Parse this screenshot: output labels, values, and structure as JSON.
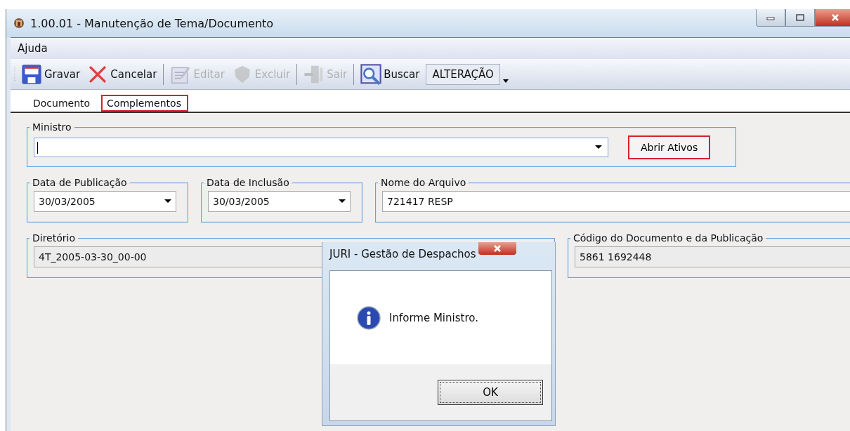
{
  "window": {
    "title": "1.00.01 - Manutenção de Tema/Documento"
  },
  "menu": [
    {
      "label": "Ajuda"
    }
  ],
  "toolbar": [
    {
      "label": "Gravar",
      "disabled": false
    },
    {
      "label": "Cancelar",
      "disabled": false
    },
    {
      "label": "Editar",
      "disabled": true
    },
    {
      "label": "Excluir",
      "disabled": true
    },
    {
      "label": "Sair",
      "disabled": true
    },
    {
      "label": "Buscar",
      "disabled": false
    }
  ],
  "mode": {
    "value": "ALTERAÇÃO"
  },
  "tabs": [
    {
      "label": "Documento",
      "selected": false
    },
    {
      "label": "Complementos",
      "selected": true
    }
  ],
  "ministro": {
    "label": "Ministro",
    "button": {
      "label": "Abrir Ativos",
      "highlighted": true
    }
  },
  "rows": [
    {
      "fields": [
        {
          "label": "Data de Publicação",
          "value": "30/03/2005",
          "kind": "date"
        },
        {
          "label": "Data de Inclusão",
          "value": "30/03/2005",
          "kind": "date"
        },
        {
          "label": "Nome do Arquivo",
          "value": "721417 RESP",
          "kind": "text"
        }
      ]
    },
    {
      "fields": [
        {
          "label": "Diretório",
          "value": "4T_2005-03-30_00-00",
          "kind": "readonly"
        },
        {
          "label": "Código do Documento e da Publicação",
          "value": "5861 1692448",
          "kind": "readonly"
        }
      ]
    }
  ],
  "dialog": {
    "title": "JURI - Gestão de Despachos",
    "message": "Informe Ministro.",
    "buttons": [
      "OK"
    ]
  }
}
